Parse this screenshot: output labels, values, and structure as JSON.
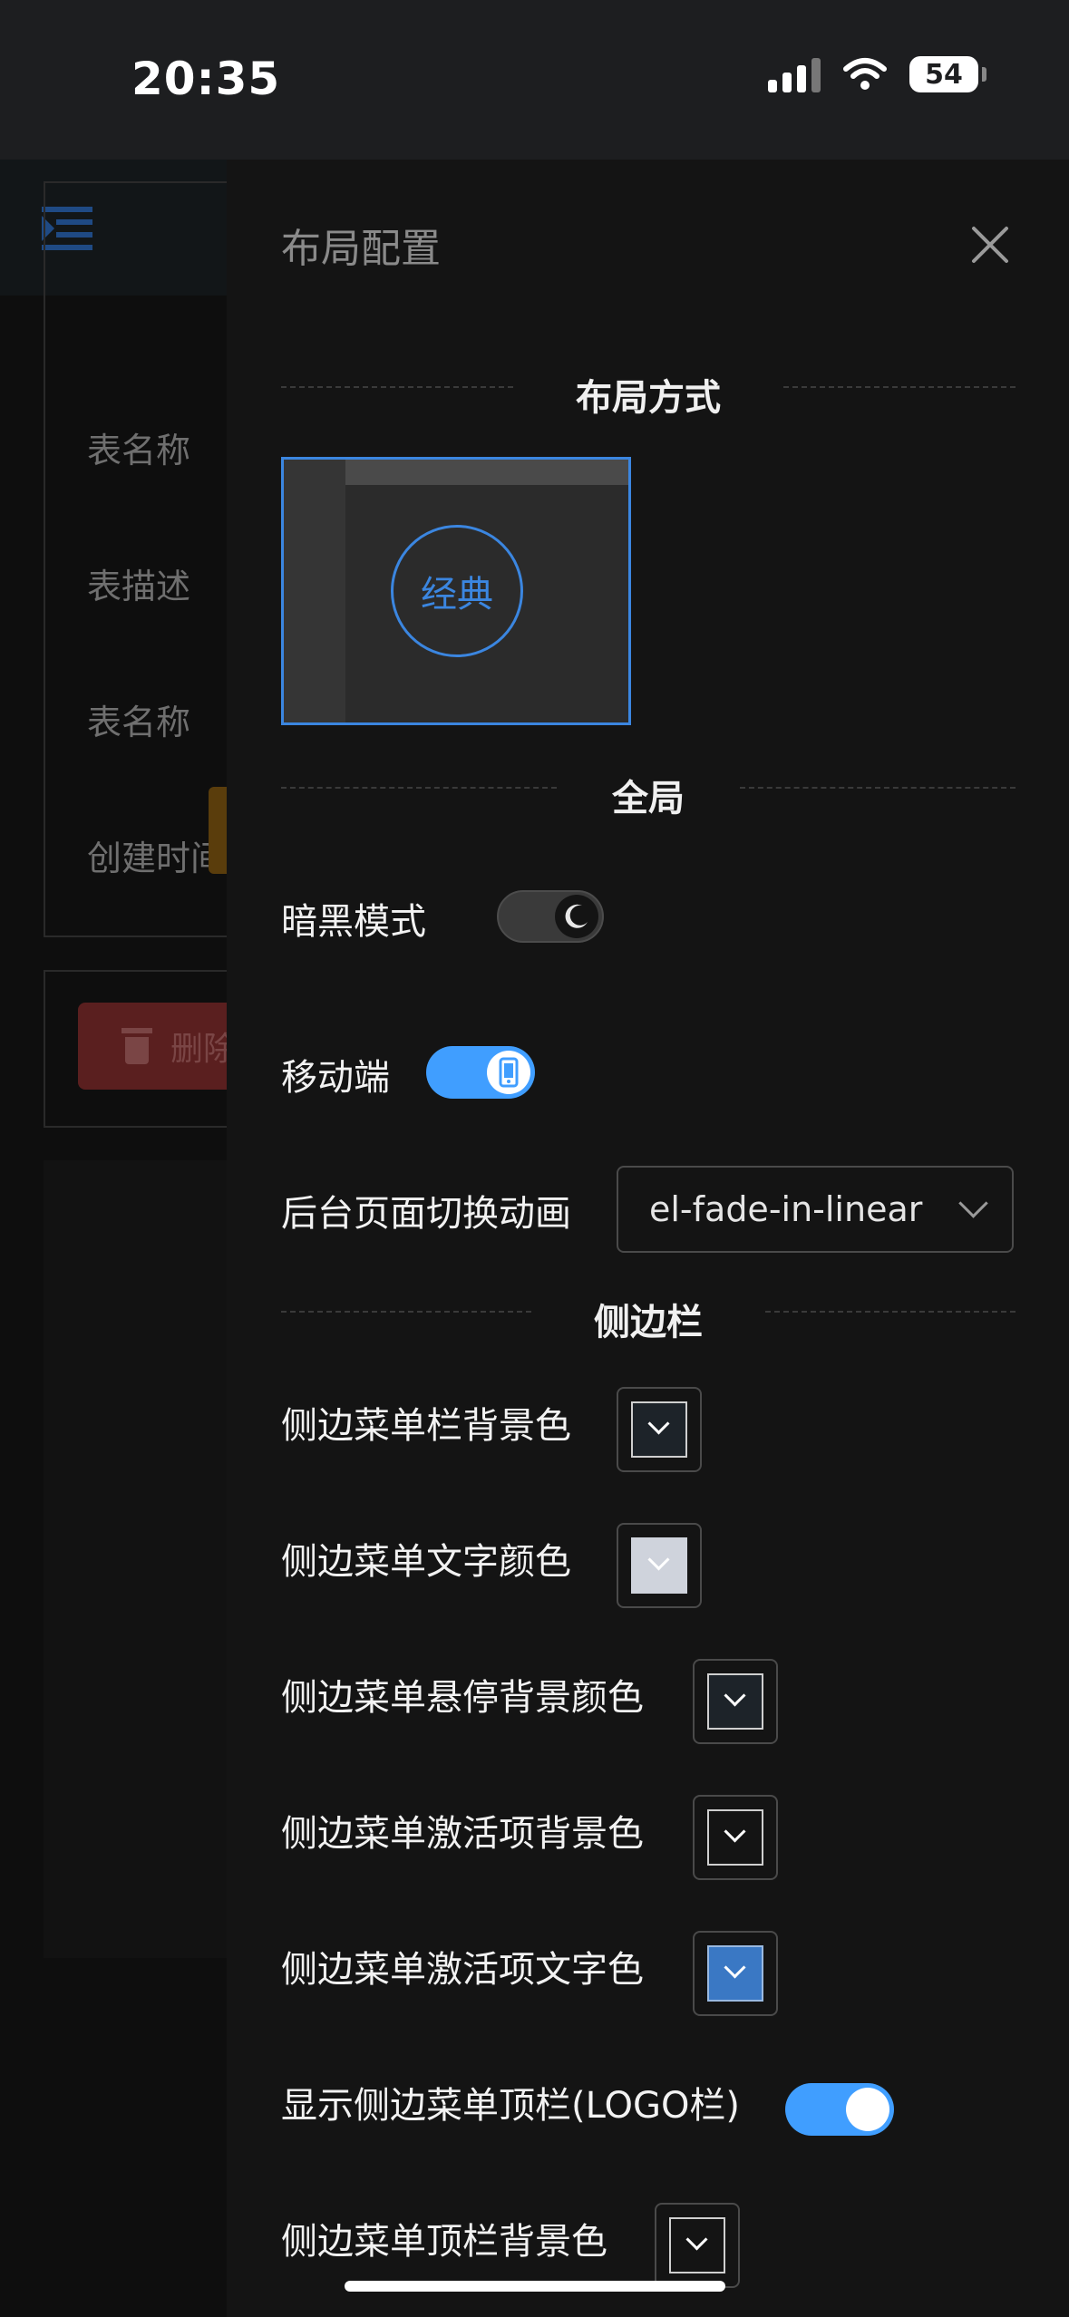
{
  "status_bar": {
    "time": "20:35",
    "battery": "54"
  },
  "background": {
    "labels": [
      "表名称",
      "表描述",
      "表名称",
      "创建时间"
    ],
    "delete_button": "删除"
  },
  "drawer": {
    "title": "布局配置",
    "sections": {
      "layout": "布局方式",
      "global": "全局",
      "sidebar": "侧边栏"
    },
    "layout_option": "经典",
    "dark_mode": {
      "label": "暗黑模式",
      "on": false
    },
    "mobile": {
      "label": "移动端",
      "on": true
    },
    "page_transition": {
      "label": "后台页面切换动画",
      "value": "el-fade-in-linear"
    },
    "sidebar_colors": [
      {
        "label": "侧边菜单栏背景色",
        "color": "#1d2329"
      },
      {
        "label": "侧边菜单文字颜色",
        "color": "#cfd3dc"
      },
      {
        "label": "侧边菜单悬停背景颜色",
        "color": "#1d2329"
      },
      {
        "label": "侧边菜单激活项背景色",
        "color": "#141414"
      },
      {
        "label": "侧边菜单激活项文字色",
        "color": "#3a78c4"
      }
    ],
    "show_logo": {
      "label": "显示侧边菜单顶栏(LOGO栏)",
      "on": true
    },
    "topbar_bg": {
      "label": "侧边菜单顶栏背景色",
      "color": "#141414"
    }
  },
  "colors": {
    "accent": "#409eff",
    "drawer_bg": "#141414"
  }
}
